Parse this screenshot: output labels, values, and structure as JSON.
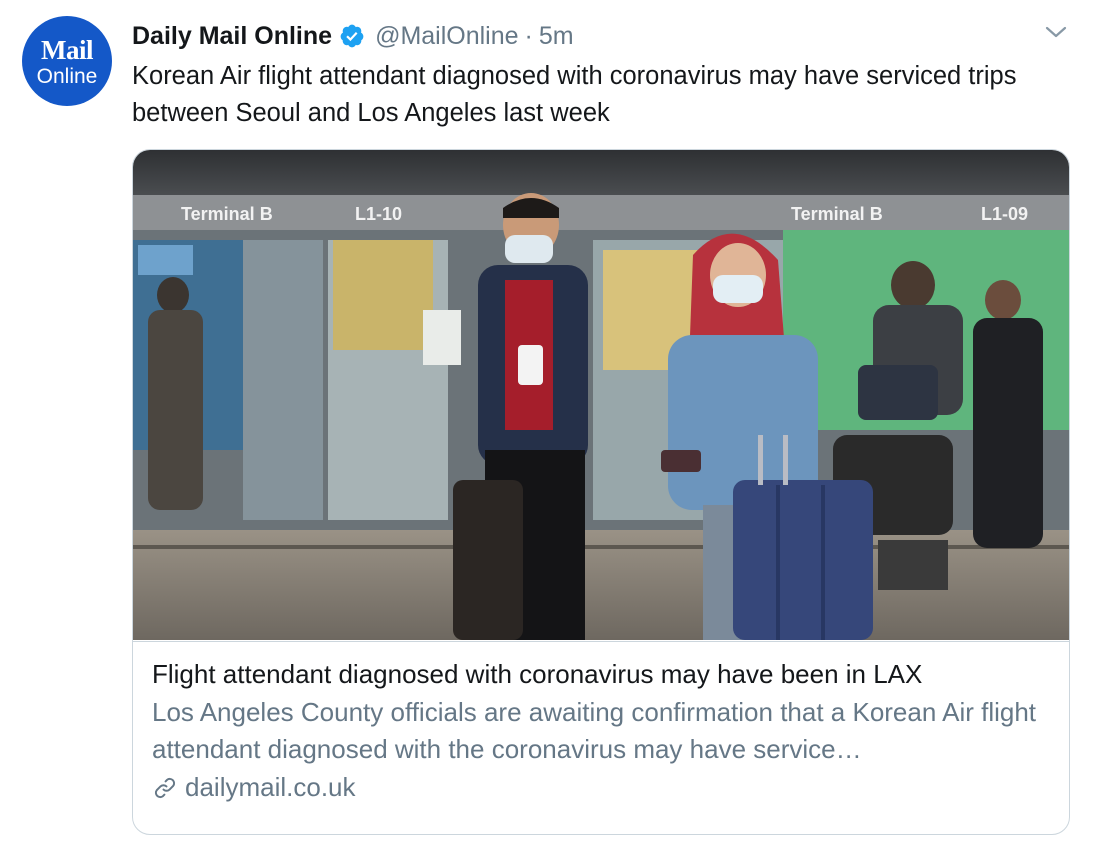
{
  "tweet": {
    "avatar": {
      "logo_top": "Mail",
      "logo_bottom": "Online",
      "color": "#1458c8"
    },
    "display_name": "Daily Mail Online",
    "verified_icon": "verified-badge-icon",
    "handle": "@MailOnline",
    "separator": "·",
    "time": "5m",
    "menu_icon": "chevron-down-icon",
    "text": "Korean Air flight attendant diagnosed with coronavirus may have serviced trips between Seoul and Los Angeles last week"
  },
  "card": {
    "image": {
      "signs": [
        "Terminal B",
        "L1-10",
        "Terminal B",
        "L1-09"
      ],
      "content_icon": "airport-travelers-photo"
    },
    "title": "Flight attendant diagnosed with coronavirus may have been in LAX",
    "description": "Los Angeles County officials are awaiting confirmation that a Korean Air flight attendant diagnosed with the coronavirus may have service…",
    "link_icon": "link-icon",
    "domain": "dailymail.co.uk"
  },
  "colors": {
    "text_primary": "#14171a",
    "text_secondary": "#657786",
    "verified": "#1da1f2",
    "border": "#ccd6dd"
  }
}
